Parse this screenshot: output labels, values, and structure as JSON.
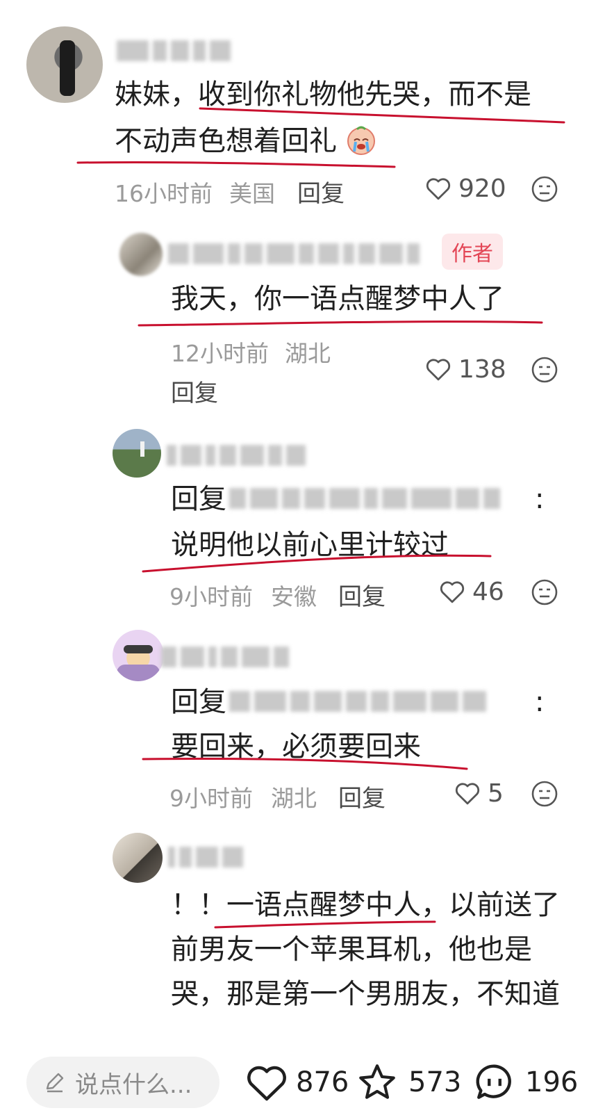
{
  "comments": [
    {
      "text_line1": "妹妹，收到你礼物他先哭，而不是",
      "text_line2": "不动声色想着回礼",
      "time": "16小时前",
      "location": "美国",
      "reply_label": "回复",
      "likes": "920"
    },
    {
      "author_badge": "作者",
      "text": "我天，你一语点醒梦中人了",
      "time": "12小时前",
      "location": "湖北",
      "reply_label": "回复",
      "likes": "138"
    },
    {
      "reply_prefix": "回复",
      "reply_suffix": ":",
      "text": "说明他以前心里计较过",
      "time": "9小时前",
      "location": "安徽",
      "reply_label": "回复",
      "likes": "46"
    },
    {
      "reply_prefix": "回复",
      "reply_suffix": ":",
      "text": "要回来，必须要回来",
      "time": "9小时前",
      "location": "湖北",
      "reply_label": "回复",
      "likes": "5"
    },
    {
      "text_line1": "！！一语点醒梦中人，以前送了",
      "text_line2": "前男友一个苹果耳机，他也是",
      "text_line3": "哭，那是第一个男朋友，不知道"
    }
  ],
  "bottom_bar": {
    "input_placeholder": "说点什么...",
    "likes": "876",
    "favorites": "573",
    "comments": "196"
  },
  "icons": {
    "like": "heart-outline-icon",
    "meh": "meh-face-icon",
    "edit": "pencil-icon",
    "star": "star-outline-icon",
    "comment": "comment-bubble-icon"
  },
  "colors": {
    "underline": "#c8102e",
    "meta": "#9a9a9a",
    "badge_bg": "#fde8ea",
    "badge_text": "#e34656"
  }
}
